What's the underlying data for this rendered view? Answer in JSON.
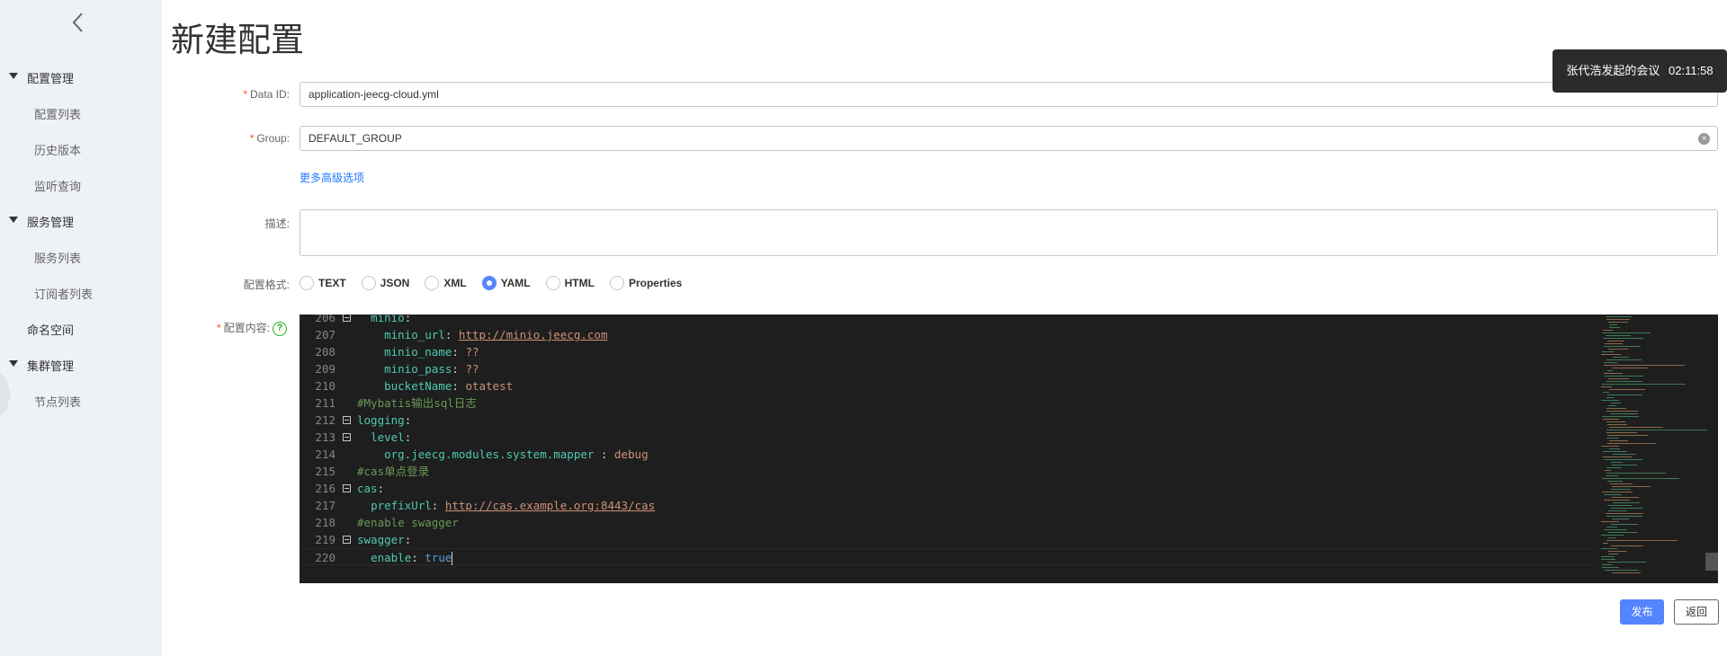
{
  "sidebar": {
    "groups": [
      {
        "label": "配置管理",
        "items": [
          "配置列表",
          "历史版本",
          "监听查询"
        ]
      },
      {
        "label": "服务管理",
        "items": [
          "服务列表",
          "订阅者列表"
        ]
      },
      {
        "standalone": "命名空间"
      },
      {
        "label": "集群管理",
        "items": [
          "节点列表"
        ]
      }
    ]
  },
  "page": {
    "title": "新建配置"
  },
  "form": {
    "data_id": {
      "label": "Data ID:",
      "value": "application-jeecg-cloud.yml"
    },
    "group": {
      "label": "Group:",
      "value": "DEFAULT_GROUP"
    },
    "advanced_link": "更多高级选项",
    "description": {
      "label": "描述:",
      "value": ""
    },
    "format": {
      "label": "配置格式:",
      "options": [
        "TEXT",
        "JSON",
        "XML",
        "YAML",
        "HTML",
        "Properties"
      ],
      "selected": "YAML"
    },
    "content": {
      "label": "配置内容",
      "colon": ":"
    }
  },
  "editor": {
    "lines": [
      {
        "n": "206",
        "fold": true,
        "text": "  minio:"
      },
      {
        "n": "207",
        "fold": false,
        "text": "    minio_url: http://minio.jeecg.com"
      },
      {
        "n": "208",
        "fold": false,
        "text": "    minio_name: ??"
      },
      {
        "n": "209",
        "fold": false,
        "text": "    minio_pass: ??"
      },
      {
        "n": "210",
        "fold": false,
        "text": "    bucketName: otatest"
      },
      {
        "n": "211",
        "fold": false,
        "text": "#Mybatis输出sql日志"
      },
      {
        "n": "212",
        "fold": true,
        "text": "logging:"
      },
      {
        "n": "213",
        "fold": true,
        "text": "  level:"
      },
      {
        "n": "214",
        "fold": false,
        "text": "    org.jeecg.modules.system.mapper : debug"
      },
      {
        "n": "215",
        "fold": false,
        "text": "#cas单点登录"
      },
      {
        "n": "216",
        "fold": true,
        "text": "cas:"
      },
      {
        "n": "217",
        "fold": false,
        "text": "  prefixUrl: http://cas.example.org:8443/cas"
      },
      {
        "n": "218",
        "fold": false,
        "text": "#enable swagger"
      },
      {
        "n": "219",
        "fold": true,
        "text": "swagger:"
      },
      {
        "n": "220",
        "fold": false,
        "text": "  enable: true"
      }
    ]
  },
  "buttons": {
    "publish": "发布",
    "back": "返回"
  },
  "toast": {
    "text": "张代浩发起的会议",
    "time": "02:11:58"
  },
  "icons": {
    "back": "chevron-left-icon",
    "help": "question-circle-icon",
    "clear": "clear-circle-icon"
  },
  "colors": {
    "primary": "#5584ff",
    "sidebar_bg": "#eef1f6",
    "editor_bg": "#1e1e1e",
    "required": "#fa541c"
  }
}
